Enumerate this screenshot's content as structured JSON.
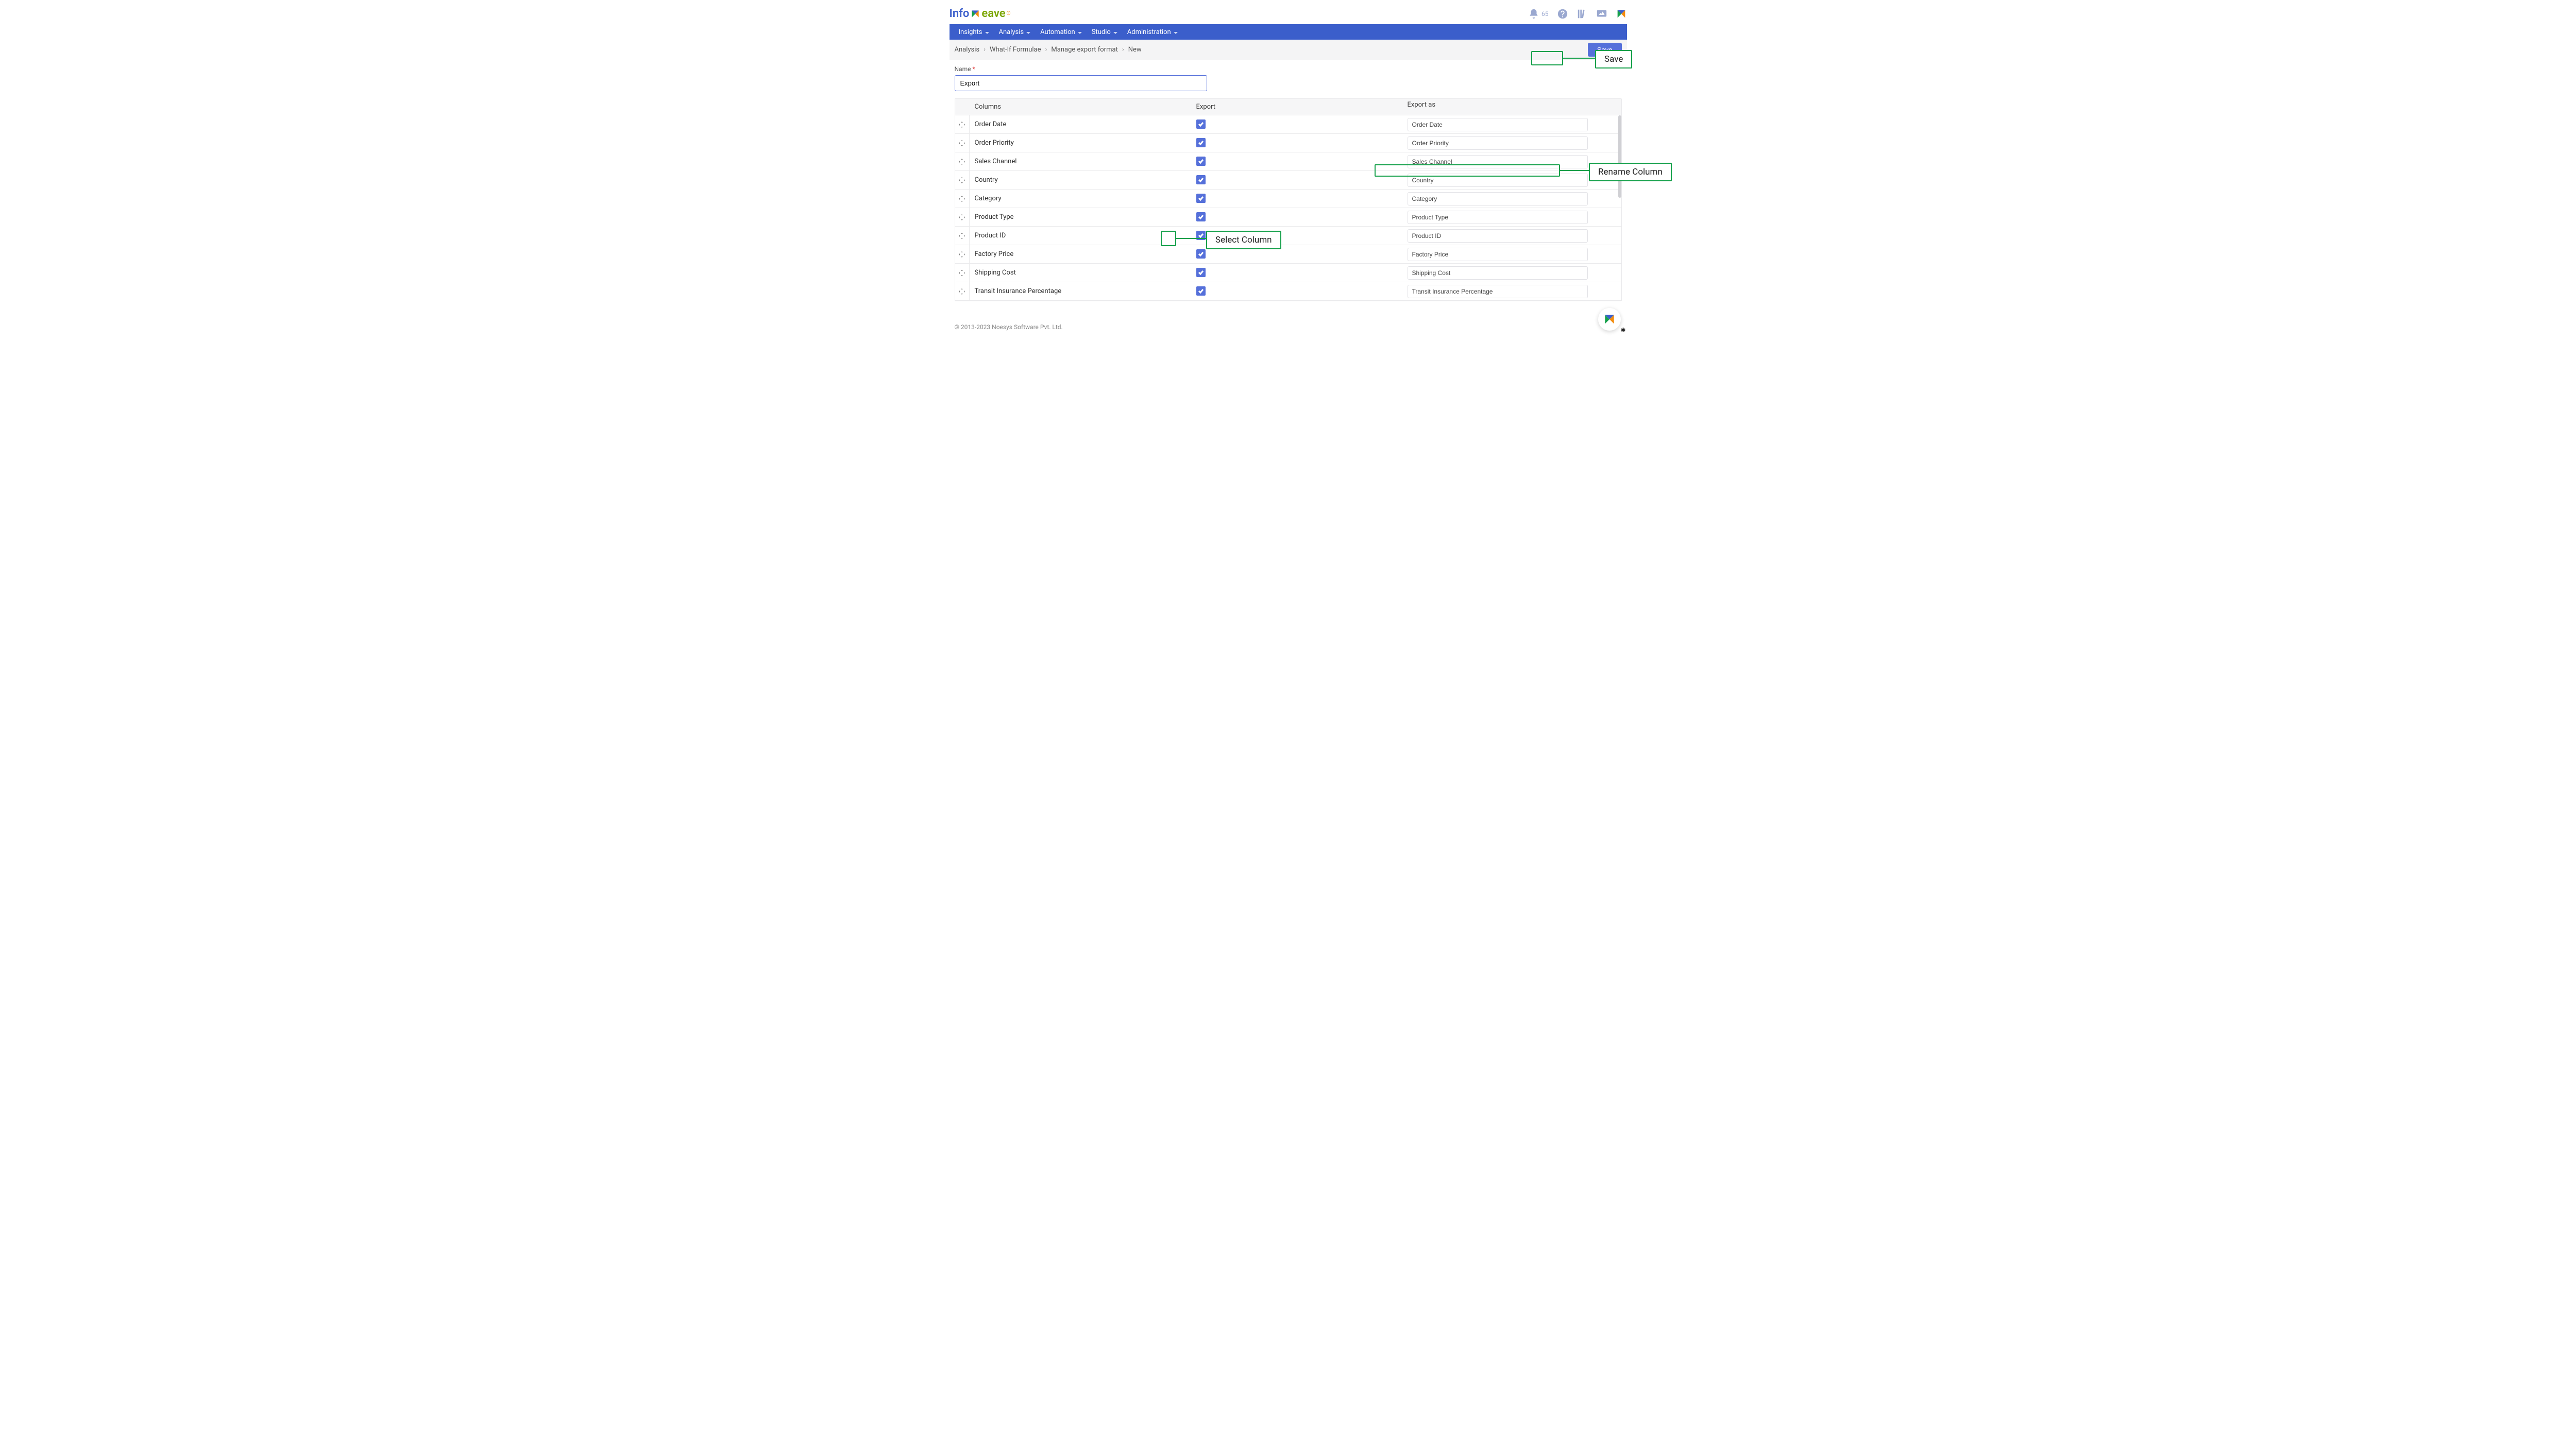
{
  "logo": {
    "part1": "Info",
    "part2": "eave",
    "sup": "®"
  },
  "topIcons": {
    "notifCount": "65"
  },
  "nav": {
    "items": [
      {
        "label": "Insights"
      },
      {
        "label": "Analysis"
      },
      {
        "label": "Automation"
      },
      {
        "label": "Studio"
      },
      {
        "label": "Administration"
      }
    ]
  },
  "breadcrumb": {
    "items": [
      "Analysis",
      "What-If Formulae",
      "Manage export format",
      "New"
    ]
  },
  "saveLabel": "Save",
  "nameField": {
    "label": "Name",
    "value": "Export"
  },
  "table": {
    "headers": {
      "columns": "Columns",
      "export": "Export",
      "exportAs": "Export as"
    },
    "rows": [
      {
        "col": "Order Date",
        "checked": true,
        "as": "Order Date"
      },
      {
        "col": "Order Priority",
        "checked": true,
        "as": "Order Priority"
      },
      {
        "col": "Sales Channel",
        "checked": true,
        "as": "Sales Channel"
      },
      {
        "col": "Country",
        "checked": true,
        "as": "Country"
      },
      {
        "col": "Category",
        "checked": true,
        "as": "Category"
      },
      {
        "col": "Product Type",
        "checked": true,
        "as": "Product Type"
      },
      {
        "col": "Product ID",
        "checked": true,
        "as": "Product ID"
      },
      {
        "col": "Factory Price",
        "checked": true,
        "as": "Factory Price"
      },
      {
        "col": "Shipping Cost",
        "checked": true,
        "as": "Shipping Cost"
      },
      {
        "col": "Transit Insurance Percentage",
        "checked": true,
        "as": "Transit Insurance Percentage"
      }
    ]
  },
  "annotations": {
    "save": "Save",
    "rename": "Rename Column",
    "select": "Select Column"
  },
  "footer": {
    "copyright": "© 2013-2023 Noesys Software Pvt. Ltd."
  }
}
